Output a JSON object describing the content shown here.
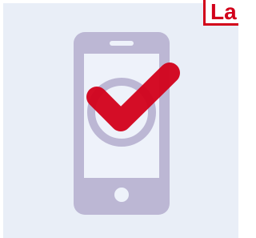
{
  "badge": {
    "text": "La"
  },
  "colors": {
    "background": "#e9eef7",
    "phone": "#bcb7d4",
    "screen": "#eef2fa",
    "check": "#d2001a",
    "badge_border": "#d2001a"
  },
  "icons": {
    "main": "smartphone-icon",
    "overlay": "checkmark-icon"
  }
}
